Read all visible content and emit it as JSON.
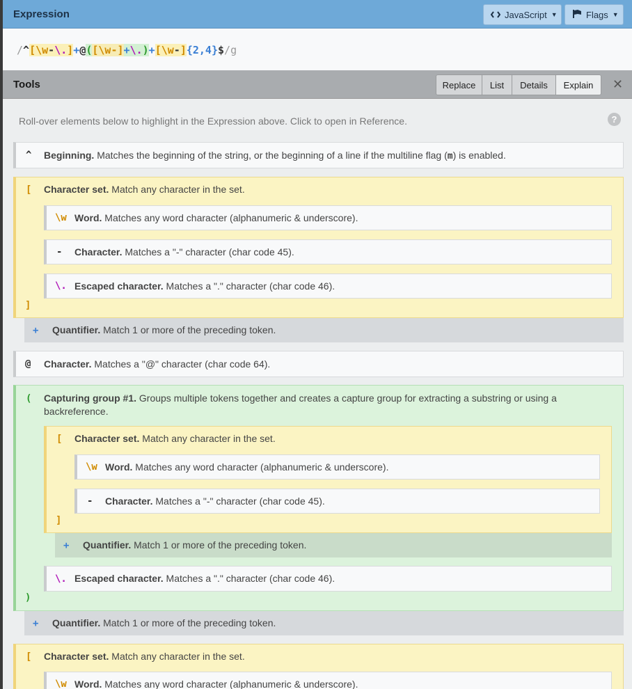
{
  "expression_panel": {
    "title": "Expression",
    "flavor_button": "JavaScript",
    "flags_button": "Flags"
  },
  "expression": {
    "open_delim": "/",
    "anchor": "^",
    "set1_open": "[",
    "set1_w": "\\w",
    "set1_dash": "-",
    "set1_esc": "\\.",
    "set1_close": "]",
    "quant1": "+",
    "at": "@",
    "group_open": "(",
    "gset_open": "[",
    "gset_w": "\\w",
    "gset_dash": "-",
    "gset_close": "]",
    "gquant": "+",
    "gesc": "\\.",
    "group_close": ")",
    "quant2": "+",
    "set3_open": "[",
    "set3_w": "\\w",
    "set3_dash": "-",
    "set3_close": "]",
    "range": "{2,4}",
    "end_anchor": "$",
    "close_delim": "/",
    "flag": "g"
  },
  "tools_panel": {
    "title": "Tools",
    "tabs": [
      "Replace",
      "List",
      "Details",
      "Explain"
    ],
    "active_tab": "Explain"
  },
  "explain": {
    "hint": "Roll-over elements below to highlight in the Expression above. Click to open in Reference.",
    "help": "?",
    "beginning": {
      "token": "^",
      "name": "Beginning.",
      "text_a": "Matches the beginning of the string, or the beginning of a line if the multiline flag (",
      "code": "m",
      "text_b": ") is enabled."
    },
    "charset_name": "Character set.",
    "charset_text": "Match any character in the set.",
    "word_name": "Word.",
    "word_text": "Matches any word character (alphanumeric & underscore).",
    "char_name": "Character.",
    "dash_text": "Matches a \"-\" character (char code 45).",
    "escaped_name": "Escaped character.",
    "dot_text": "Matches a \".\" character (char code 46).",
    "quant_name": "Quantifier.",
    "quant_text": "Match 1 or more of the preceding token.",
    "at_text": "Matches a \"@\" character (char code 64).",
    "group_name": "Capturing group #1.",
    "group_text": "Groups multiple tokens together and creates a capture group for extracting a substring or using a backreference.",
    "tok_open_set": "[",
    "tok_close_set": "]",
    "tok_w": "\\w",
    "tok_dash": "-",
    "tok_esc_dot": "\\.",
    "tok_plus": "+",
    "tok_at": "@",
    "tok_open_group": "(",
    "tok_close_group": ")"
  },
  "colors": {
    "expression_header": "#6ea9d8",
    "tools_header": "#a9acaf",
    "set_background": "#fbf4c3",
    "group_background": "#dcf3dc",
    "set_token": "#d08b00",
    "escape_token": "#b018b8",
    "quantifier_token": "#3a7fd4",
    "group_token": "#2d9a2d"
  }
}
